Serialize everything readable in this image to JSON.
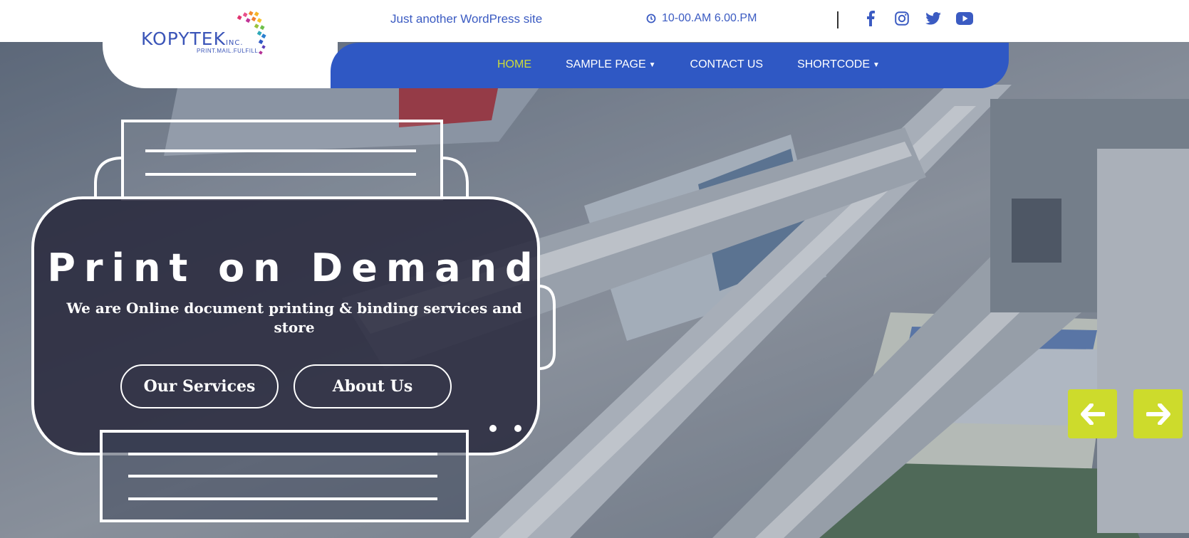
{
  "header": {
    "tagline": "Just another WordPress site",
    "hours": "10-00.AM 6.00.PM",
    "social": [
      "facebook-icon",
      "instagram-icon",
      "twitter-icon",
      "youtube-icon"
    ]
  },
  "logo": {
    "name": "KOPYTEK",
    "suffix": "INC.",
    "tagline": "PRINT.MAIL.FULFILL."
  },
  "nav": {
    "items": [
      {
        "label": "HOME",
        "active": true,
        "dropdown": false
      },
      {
        "label": "SAMPLE PAGE",
        "active": false,
        "dropdown": true
      },
      {
        "label": "CONTACT US",
        "active": false,
        "dropdown": false
      },
      {
        "label": "SHORTCODE",
        "active": false,
        "dropdown": true
      }
    ]
  },
  "slide": {
    "title": "Print on Demand",
    "subtitle": "We are Online document printing & binding services and store",
    "buttons": [
      "Our Services",
      "About Us"
    ],
    "dot_count": 2
  },
  "colors": {
    "brand_blue": "#2f58c4",
    "accent_lime": "#cddb2c",
    "active_nav": "#cddb39"
  },
  "slider_controls": [
    "arrow-left-icon",
    "arrow-right-icon"
  ]
}
